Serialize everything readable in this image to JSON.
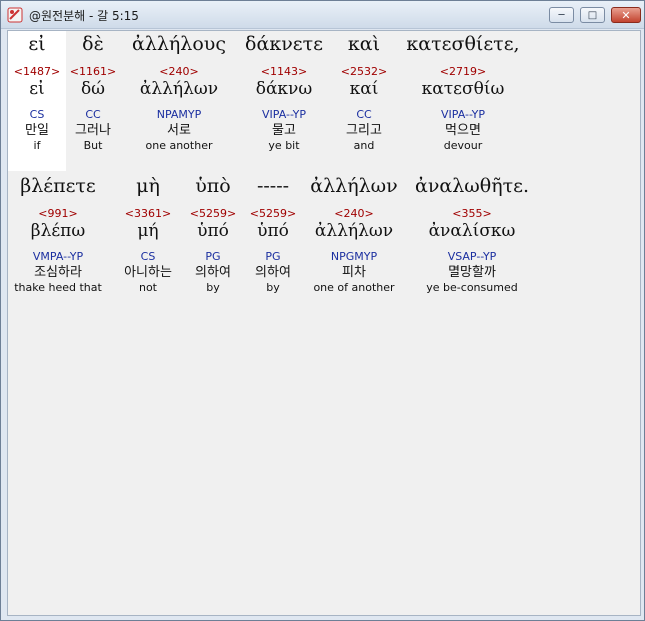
{
  "window": {
    "title": "@원전분해 - 갈 5:15",
    "minimize_glyph": "─",
    "maximize_glyph": "□",
    "close_glyph": "✕"
  },
  "lines": [
    {
      "words": [
        {
          "greek": "εἰ",
          "strong": "<1487>",
          "lemma": "εἰ",
          "parse": "CS",
          "korean": "만일",
          "english": "if"
        },
        {
          "greek": "δὲ",
          "strong": "<1161>",
          "lemma": "δώ",
          "parse": "CC",
          "korean": "그러나",
          "english": "But"
        },
        {
          "greek": "ἀλλήλους",
          "strong": "<240>",
          "lemma": "ἀλλήλων",
          "parse": "NPAMYP",
          "korean": "서로",
          "english": "one another"
        },
        {
          "greek": "δάκνετε",
          "strong": "<1143>",
          "lemma": "δάκνω",
          "parse": "VIPA--YP",
          "korean": "물고",
          "english": "ye bit"
        },
        {
          "greek": "καὶ",
          "strong": "<2532>",
          "lemma": "καί",
          "parse": "CC",
          "korean": "그리고",
          "english": "and"
        },
        {
          "greek": "κατεσθίετε,",
          "strong": "<2719>",
          "lemma": "κατεσθίω",
          "parse": "VIPA--YP",
          "korean": "먹으면",
          "english": "devour"
        }
      ]
    },
    {
      "words": [
        {
          "greek": "βλέπετε",
          "strong": "<991>",
          "lemma": "βλέπω",
          "parse": "VMPA--YP",
          "korean": "조심하라",
          "english": "thake heed that"
        },
        {
          "greek": "μὴ",
          "strong": "<3361>",
          "lemma": "μή",
          "parse": "CS",
          "korean": "아니하는",
          "english": "not"
        },
        {
          "greek": "ὑπὸ",
          "strong": "<5259>",
          "lemma": "ὑπό",
          "parse": "PG",
          "korean": "의하여",
          "english": "by"
        },
        {
          "greek": "-----",
          "strong": "<5259>",
          "lemma": "ὑπό",
          "parse": "PG",
          "korean": "의하여",
          "english": "by"
        },
        {
          "greek": "ἀλλήλων",
          "strong": "<240>",
          "lemma": "ἀλλήλων",
          "parse": "NPGMYP",
          "korean": "피차",
          "english": "one of another"
        },
        {
          "greek": "ἀναλωθῆτε.",
          "strong": "<355>",
          "lemma": "ἀναλίσκω",
          "parse": "VSAP--YP",
          "korean": "멸망할까",
          "english": "ye be-consumed"
        }
      ]
    }
  ]
}
